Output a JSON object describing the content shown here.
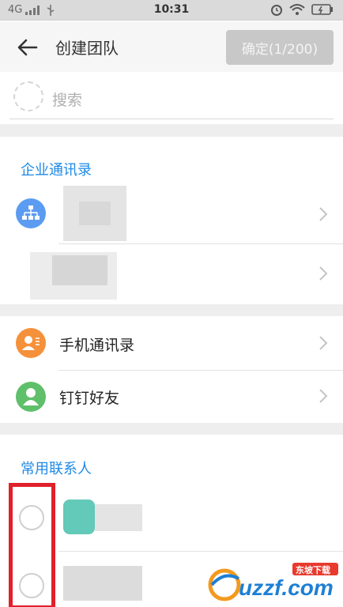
{
  "status_bar": {
    "network": "4G",
    "time": "10:31"
  },
  "header": {
    "title": "创建团队",
    "confirm_label": "确定(1/200)"
  },
  "search": {
    "placeholder": "搜索"
  },
  "sections": {
    "enterprise_title": "企业通讯录",
    "frequent_title": "常用联系人"
  },
  "rows": {
    "phone_contacts": "手机通讯录",
    "dingtalk_friends": "钉钉好友"
  },
  "watermark": {
    "brand": "uzzf.com",
    "tag": "东坡下载"
  },
  "colors": {
    "accent": "#1e8ae6",
    "org_avatar": "#5b9cf2",
    "phone_avatar": "#f5913a",
    "friend_avatar": "#5fbf6a",
    "highlight_border": "#e0202a"
  },
  "icons": {
    "back": "arrow-left-icon",
    "org": "org-chart-icon",
    "phone": "contact-card-icon",
    "friend": "person-icon",
    "chevron": "chevron-right-icon"
  }
}
